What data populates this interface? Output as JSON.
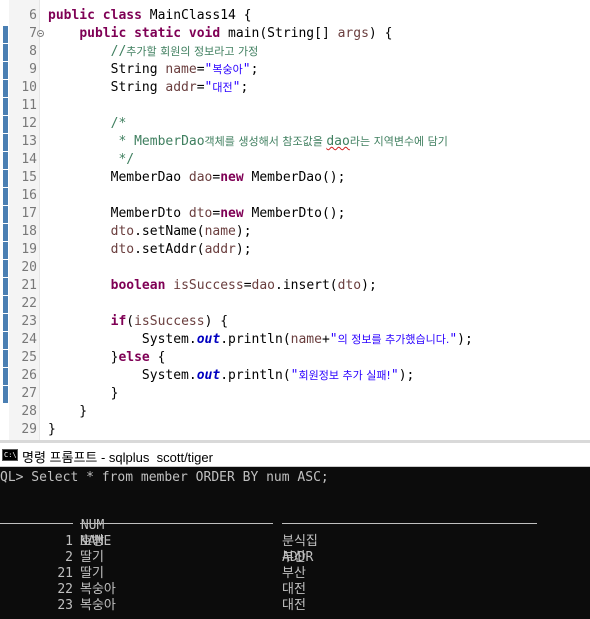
{
  "editor": {
    "lines": [
      {
        "n": "6",
        "fold": false,
        "parts": [
          [
            "kw",
            "public class "
          ],
          [
            "",
            "MainClass14 {"
          ]
        ]
      },
      {
        "n": "7",
        "fold": true,
        "parts": [
          [
            "",
            "    "
          ],
          [
            "kw",
            "public static void "
          ],
          [
            "",
            "main(String[] "
          ],
          [
            "var",
            "args"
          ],
          [
            "",
            ") {"
          ]
        ]
      },
      {
        "n": "8",
        "fold": false,
        "parts": [
          [
            "",
            "        "
          ],
          [
            "cm",
            "//"
          ],
          [
            "cm ko",
            "추가할 회원의 정보라고 가정"
          ]
        ]
      },
      {
        "n": "9",
        "fold": false,
        "parts": [
          [
            "",
            "        String "
          ],
          [
            "var",
            "name"
          ],
          [
            "",
            "="
          ],
          [
            "str",
            "\""
          ],
          [
            "str ko",
            "복숭아"
          ],
          [
            "str",
            "\""
          ],
          [
            "",
            ";"
          ]
        ]
      },
      {
        "n": "10",
        "fold": false,
        "parts": [
          [
            "",
            "        String "
          ],
          [
            "var",
            "addr"
          ],
          [
            "",
            "="
          ],
          [
            "str",
            "\""
          ],
          [
            "str ko",
            "대전"
          ],
          [
            "str",
            "\""
          ],
          [
            "",
            ";"
          ]
        ]
      },
      {
        "n": "11",
        "fold": false,
        "parts": []
      },
      {
        "n": "12",
        "fold": false,
        "parts": [
          [
            "",
            "        "
          ],
          [
            "cm",
            "/*"
          ]
        ]
      },
      {
        "n": "13",
        "fold": false,
        "parts": [
          [
            "",
            "        "
          ],
          [
            "cm",
            " * MemberDao"
          ],
          [
            "cm ko",
            "객체를 생성해서 참조값을 "
          ],
          [
            "cm squig",
            "dao"
          ],
          [
            "cm ko",
            "라는 지역변수에 담기"
          ]
        ]
      },
      {
        "n": "14",
        "fold": false,
        "parts": [
          [
            "",
            "        "
          ],
          [
            "cm",
            " */"
          ]
        ]
      },
      {
        "n": "15",
        "fold": false,
        "parts": [
          [
            "",
            "        MemberDao "
          ],
          [
            "var",
            "dao"
          ],
          [
            "",
            "="
          ],
          [
            "kw",
            "new "
          ],
          [
            "",
            "MemberDao();"
          ]
        ]
      },
      {
        "n": "16",
        "fold": false,
        "parts": []
      },
      {
        "n": "17",
        "fold": false,
        "parts": [
          [
            "",
            "        MemberDto "
          ],
          [
            "var",
            "dto"
          ],
          [
            "",
            "="
          ],
          [
            "kw",
            "new "
          ],
          [
            "",
            "MemberDto();"
          ]
        ]
      },
      {
        "n": "18",
        "fold": false,
        "parts": [
          [
            "",
            "        "
          ],
          [
            "var",
            "dto"
          ],
          [
            "",
            ".setName("
          ],
          [
            "var",
            "name"
          ],
          [
            "",
            ");"
          ]
        ]
      },
      {
        "n": "19",
        "fold": false,
        "parts": [
          [
            "",
            "        "
          ],
          [
            "var",
            "dto"
          ],
          [
            "",
            ".setAddr("
          ],
          [
            "var",
            "addr"
          ],
          [
            "",
            ");"
          ]
        ]
      },
      {
        "n": "20",
        "fold": false,
        "parts": []
      },
      {
        "n": "21",
        "fold": false,
        "parts": [
          [
            "",
            "        "
          ],
          [
            "kw",
            "boolean "
          ],
          [
            "var",
            "isSuccess"
          ],
          [
            "",
            "="
          ],
          [
            "var",
            "dao"
          ],
          [
            "",
            ".insert("
          ],
          [
            "var",
            "dto"
          ],
          [
            "",
            ");"
          ]
        ]
      },
      {
        "n": "22",
        "fold": false,
        "parts": []
      },
      {
        "n": "23",
        "fold": false,
        "parts": [
          [
            "",
            "        "
          ],
          [
            "kw",
            "if"
          ],
          [
            "",
            "("
          ],
          [
            "var",
            "isSuccess"
          ],
          [
            "",
            ") {"
          ]
        ]
      },
      {
        "n": "24",
        "fold": false,
        "parts": [
          [
            "",
            "            System."
          ],
          [
            "fld",
            "out"
          ],
          [
            "",
            ".println("
          ],
          [
            "var",
            "name"
          ],
          [
            "",
            "+"
          ],
          [
            "str",
            "\""
          ],
          [
            "str ko",
            "의 정보를 추가했습니다."
          ],
          [
            "str",
            "\""
          ],
          [
            "",
            ");"
          ]
        ]
      },
      {
        "n": "25",
        "fold": false,
        "parts": [
          [
            "",
            "        }"
          ],
          [
            "kw",
            "else "
          ],
          [
            "",
            "{"
          ]
        ]
      },
      {
        "n": "26",
        "fold": false,
        "parts": [
          [
            "",
            "            System."
          ],
          [
            "fld",
            "out"
          ],
          [
            "",
            ".println("
          ],
          [
            "str",
            "\""
          ],
          [
            "str ko",
            "회원정보 추가 실패!"
          ],
          [
            "str",
            "\""
          ],
          [
            "",
            ");"
          ]
        ]
      },
      {
        "n": "27",
        "fold": false,
        "parts": [
          [
            "",
            "        }"
          ]
        ]
      },
      {
        "n": "28",
        "fold": false,
        "parts": [
          [
            "",
            "    }"
          ]
        ]
      },
      {
        "n": "29",
        "fold": false,
        "parts": [
          [
            "",
            "}"
          ]
        ]
      }
    ]
  },
  "cmd": {
    "icon_text": "C:\\",
    "title": "명령 프롬프트 - sqlplus  scott/tiger",
    "query_line": "QL> Select * from member ORDER BY num ASC;",
    "headers": {
      "num": "NUM",
      "name": "NAME",
      "addr": "ADDR"
    },
    "rows": [
      {
        "num": "1",
        "name": "호빵",
        "addr": "분식집"
      },
      {
        "num": "2",
        "name": "딸기",
        "addr": "부산"
      },
      {
        "num": "21",
        "name": "딸기",
        "addr": "부산"
      },
      {
        "num": "22",
        "name": "복숭아",
        "addr": "대전"
      },
      {
        "num": "23",
        "name": "복숭아",
        "addr": "대전"
      }
    ]
  },
  "colors": {
    "keyword": "#7f0055",
    "comment": "#3f7f5f",
    "string": "#2a00ff",
    "field": "#0000c0",
    "console_bg": "#0c0c0c",
    "console_fg": "#c0c0c0"
  }
}
